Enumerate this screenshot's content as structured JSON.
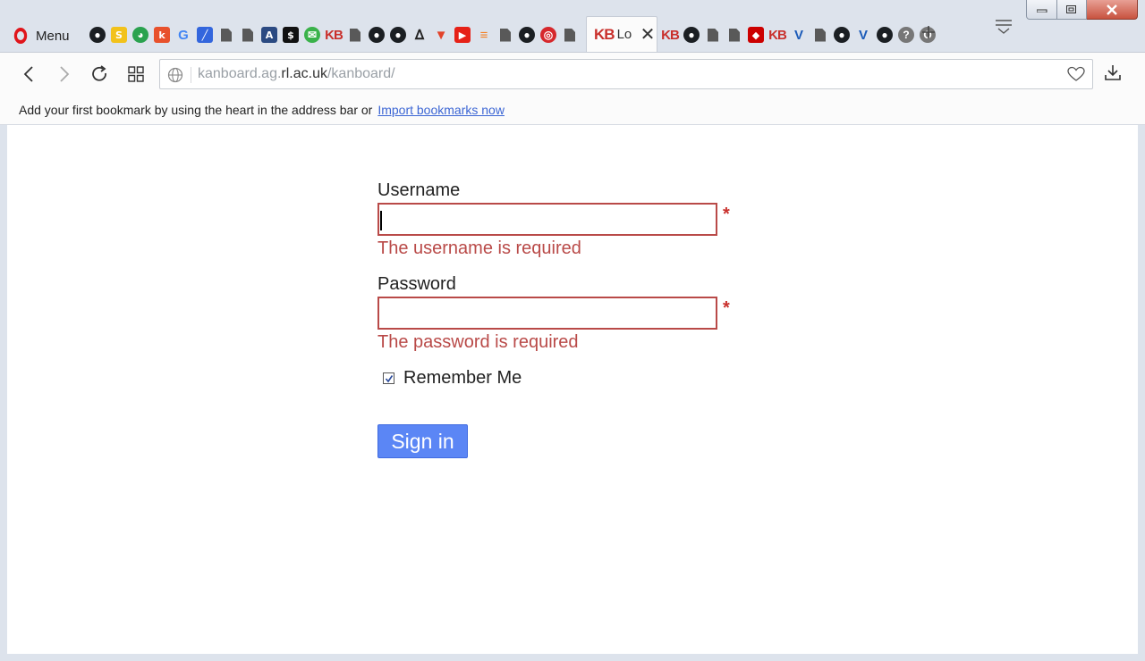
{
  "browser": {
    "menu_label": "Menu",
    "tabs_before": [
      {
        "icon": "github-icon"
      },
      {
        "icon": "sharelatex-icon"
      },
      {
        "icon": "colorful-circle-icon"
      },
      {
        "icon": "k-icon"
      },
      {
        "icon": "google-icon"
      },
      {
        "icon": "blue-slash-icon"
      },
      {
        "icon": "document-icon"
      },
      {
        "icon": "document-icon"
      },
      {
        "icon": "blue-square-icon"
      },
      {
        "icon": "dollar-icon"
      },
      {
        "icon": "green-chat-icon"
      },
      {
        "icon": "kanboard-icon"
      },
      {
        "icon": "document-icon"
      },
      {
        "icon": "github-icon"
      },
      {
        "icon": "github-icon"
      },
      {
        "icon": "linux-icon"
      },
      {
        "icon": "gitlab-icon"
      },
      {
        "icon": "youtube-icon"
      },
      {
        "icon": "stackoverflow-icon"
      },
      {
        "icon": "document-icon"
      },
      {
        "icon": "github-icon"
      },
      {
        "icon": "red-circle-icon"
      },
      {
        "icon": "document-icon"
      }
    ],
    "active_tab": {
      "icon": "kanboard-icon",
      "title": "Lo"
    },
    "tabs_after": [
      {
        "icon": "kanboard-icon"
      },
      {
        "icon": "github-icon"
      },
      {
        "icon": "document-icon"
      },
      {
        "icon": "document-icon"
      },
      {
        "icon": "redhat-icon"
      },
      {
        "icon": "kanboard-icon"
      },
      {
        "icon": "v-icon"
      },
      {
        "icon": "document-icon"
      },
      {
        "icon": "github-icon"
      },
      {
        "icon": "v-icon"
      },
      {
        "icon": "github-icon"
      },
      {
        "icon": "question-icon"
      },
      {
        "icon": "opera-icon"
      }
    ],
    "url_prefix": "kanboard.ag.",
    "url_domain": "rl.ac.uk",
    "url_path": "/kanboard/",
    "bookmark_hint": "Add your first bookmark by using the heart in the address bar or",
    "bookmark_link": "Import bookmarks now"
  },
  "colors": {
    "error": "#b94a48",
    "button": "#5b86f5",
    "link": "#3c66d4",
    "opera_red": "#e0151b"
  },
  "form": {
    "username_label": "Username",
    "username_value": "",
    "username_error": "The username is required",
    "password_label": "Password",
    "password_value": "",
    "password_error": "The password is required",
    "required_marker": "*",
    "remember_label": "Remember Me",
    "remember_checked": true,
    "signin_label": "Sign in"
  }
}
